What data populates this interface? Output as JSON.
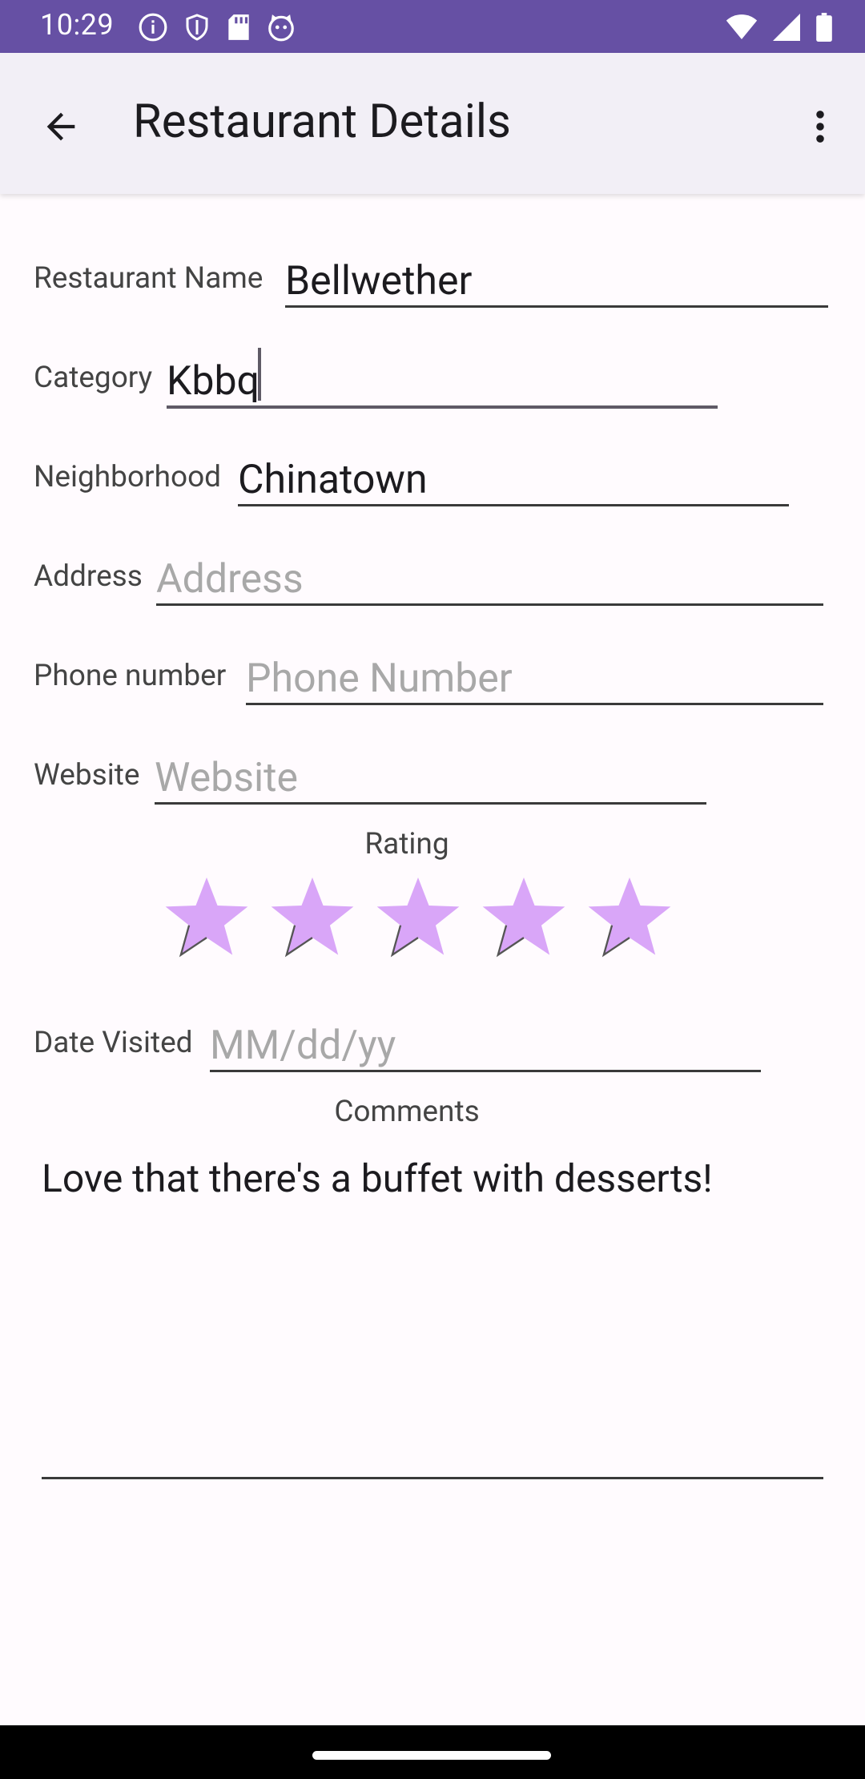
{
  "status_bar": {
    "time": "10:29",
    "left_icons": [
      "info-icon",
      "shield-icon",
      "sd-card-icon",
      "cat-face-icon"
    ],
    "right_icons": [
      "wifi-icon",
      "signal-icon",
      "battery-icon"
    ],
    "color": "#6650A4"
  },
  "app_bar": {
    "title": "Restaurant Details",
    "back_icon": "arrow-left-icon",
    "menu_icon": "more-vert-icon"
  },
  "form": {
    "name": {
      "label": "Restaurant Name",
      "value": "Bellwether",
      "placeholder": ""
    },
    "category": {
      "label": "Category",
      "value": "Kbbq",
      "placeholder": ""
    },
    "neighborhood": {
      "label": "Neighborhood",
      "value": "Chinatown",
      "placeholder": ""
    },
    "address": {
      "label": "Address",
      "value": "",
      "placeholder": "Address"
    },
    "phone": {
      "label": "Phone number",
      "value": "",
      "placeholder": "Phone Number"
    },
    "website": {
      "label": "Website",
      "value": "",
      "placeholder": "Website"
    },
    "rating": {
      "label": "Rating",
      "value": 5,
      "max": 5,
      "star_color": "#D9A6F8"
    },
    "date": {
      "label": "Date Visited",
      "value": "",
      "placeholder": "MM/dd/yy"
    },
    "comments": {
      "label": "Comments",
      "value": "Love that there's a buffet with desserts!"
    }
  }
}
